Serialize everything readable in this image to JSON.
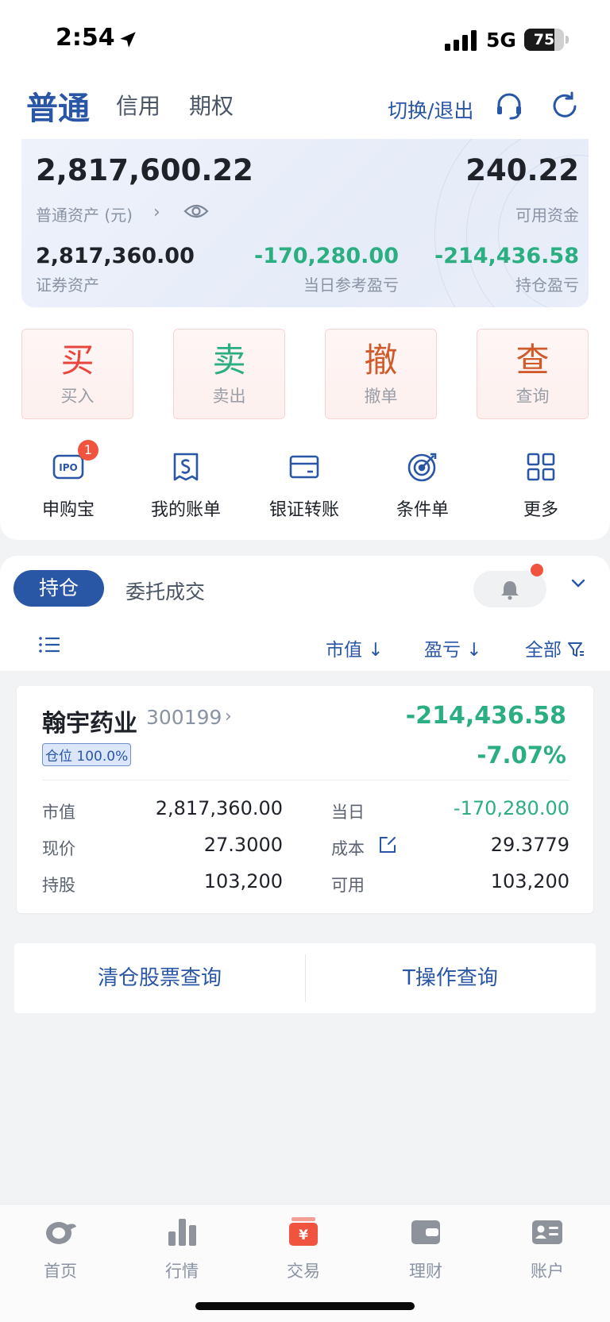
{
  "status_bar": {
    "time": "2:54",
    "network": "5G",
    "battery": "75",
    "battery_level": 0.75
  },
  "account_tabs": [
    {
      "label": "普通",
      "active": true
    },
    {
      "label": "信用",
      "active": false
    },
    {
      "label": "期权",
      "active": false
    }
  ],
  "header": {
    "switch_label": "切换/退出",
    "icons": [
      "headset-icon",
      "refresh-icon"
    ]
  },
  "assets": {
    "total": "2,817,600.22",
    "total_label": "普通资产 (元)",
    "available": "240.22",
    "available_label": "可用资金",
    "securities": "2,817,360.00",
    "securities_label": "证券资产",
    "day_pl": "-170,280.00",
    "day_pl_label": "当日参考盈亏",
    "holding_pl": "-214,436.58",
    "holding_pl_label": "持仓盈亏"
  },
  "trade_buttons": [
    {
      "char": "买",
      "label": "买入",
      "color": "#e8453c"
    },
    {
      "char": "卖",
      "label": "卖出",
      "color": "#2bae82"
    },
    {
      "char": "撤",
      "label": "撤单",
      "color": "#d05a2a"
    },
    {
      "char": "查",
      "label": "查询",
      "color": "#d05a2a"
    }
  ],
  "tools": [
    {
      "label": "申购宝",
      "icon": "ipo-icon",
      "badge": "1"
    },
    {
      "label": "我的账单",
      "icon": "bill-icon"
    },
    {
      "label": "银证转账",
      "icon": "card-icon"
    },
    {
      "label": "条件单",
      "icon": "target-icon"
    },
    {
      "label": "更多",
      "icon": "grid-icon"
    }
  ],
  "position_tabs": [
    {
      "label": "持仓",
      "active": true
    },
    {
      "label": "委托成交",
      "active": false
    }
  ],
  "sort": {
    "market_value": "市值 ↓",
    "pl": "盈亏 ↓",
    "filter": "全部"
  },
  "holding": {
    "name": "翰宇药业",
    "code": "300199",
    "ratio": "仓位 100.0%",
    "pl": "-214,436.58",
    "pl_pct": "-7.07%",
    "rows": [
      {
        "l1": "市值",
        "v1": "2,817,360.00",
        "l2": "当日",
        "v2": "-170,280.00"
      },
      {
        "l1": "现价",
        "v1": "27.3000",
        "l2": "成本",
        "v2": "29.3779"
      },
      {
        "l1": "持股",
        "v1": "103,200",
        "l2": "可用",
        "v2": "103,200"
      }
    ]
  },
  "queries": {
    "clear": "清仓股票查询",
    "t_op": "T操作查询"
  },
  "bottom_nav": [
    {
      "label": "首页",
      "icon": "home-icon",
      "active": false
    },
    {
      "label": "行情",
      "icon": "chart-icon",
      "active": false
    },
    {
      "label": "交易",
      "icon": "trade-icon",
      "active": true
    },
    {
      "label": "理财",
      "icon": "wallet-icon",
      "active": false
    },
    {
      "label": "账户",
      "icon": "account-icon",
      "active": false
    }
  ],
  "colors": {
    "brand": "#2a56a6",
    "loss": "#2bae82",
    "accent": "#f0533e"
  }
}
